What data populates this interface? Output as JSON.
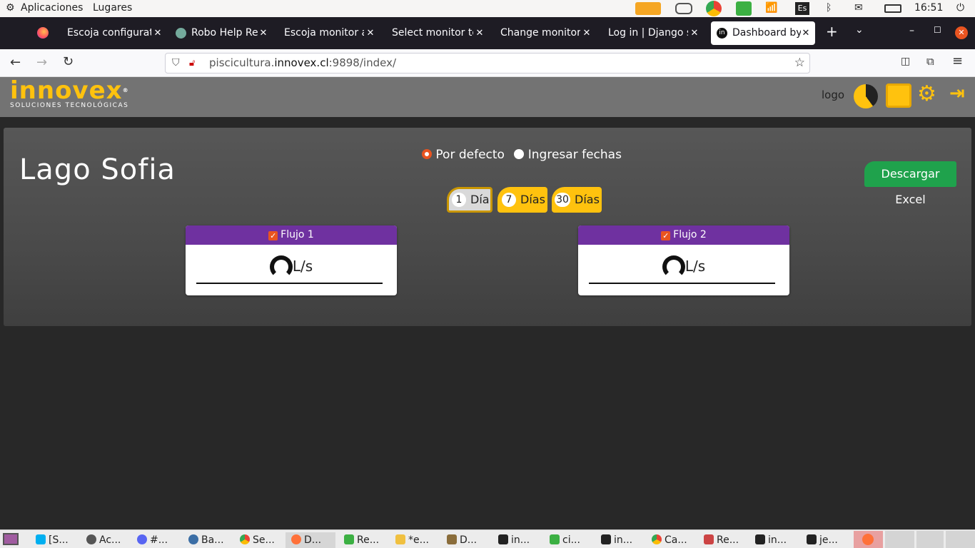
{
  "system_bar": {
    "apps": "Aplicaciones",
    "places": "Lugares",
    "keyboard": "Es",
    "time": "16:51"
  },
  "browser": {
    "tabs": [
      {
        "label": "Escoja configurati"
      },
      {
        "label": "Robo Help Rec"
      },
      {
        "label": "Escoja monitor a r"
      },
      {
        "label": "Select monitor to"
      },
      {
        "label": "Change monitor |"
      },
      {
        "label": "Log in | Django sit"
      },
      {
        "label": "Dashboard by"
      }
    ],
    "url_prefix": "piscicultura.",
    "url_domain": "innovex.cl",
    "url_suffix": ":9898/index/"
  },
  "app_header": {
    "brand": "innovex",
    "brand_sub": "SOLUCIONES TECNOLÓGICAS",
    "logo_text": "logo"
  },
  "dashboard": {
    "title": "Lago Sofia",
    "radio_default": "Por defecto",
    "radio_dates": "Ingresar fechas",
    "ranges": [
      {
        "num": "1",
        "label": "Día"
      },
      {
        "num": "7",
        "label": "Días"
      },
      {
        "num": "30",
        "label": "Días"
      }
    ],
    "download_label": "Descargar Excel",
    "cards": [
      {
        "title": "Flujo 1",
        "unit": "L/s"
      },
      {
        "title": "Flujo 2",
        "unit": "L/s"
      }
    ]
  },
  "taskbar": {
    "items": [
      {
        "label": "[S..."
      },
      {
        "label": "Ac..."
      },
      {
        "label": "#..."
      },
      {
        "label": "Ba..."
      },
      {
        "label": "Se..."
      },
      {
        "label": "D..."
      },
      {
        "label": "Re..."
      },
      {
        "label": "*e..."
      },
      {
        "label": "D..."
      },
      {
        "label": "in..."
      },
      {
        "label": "ci..."
      },
      {
        "label": "in..."
      },
      {
        "label": "Ca..."
      },
      {
        "label": "Re..."
      },
      {
        "label": "in..."
      },
      {
        "label": "je..."
      }
    ]
  },
  "colors": {
    "accent_yellow": "#ffc20e",
    "card_header": "#6f31a0",
    "download_green": "#1fa24c",
    "radio_orange": "#e95420"
  }
}
